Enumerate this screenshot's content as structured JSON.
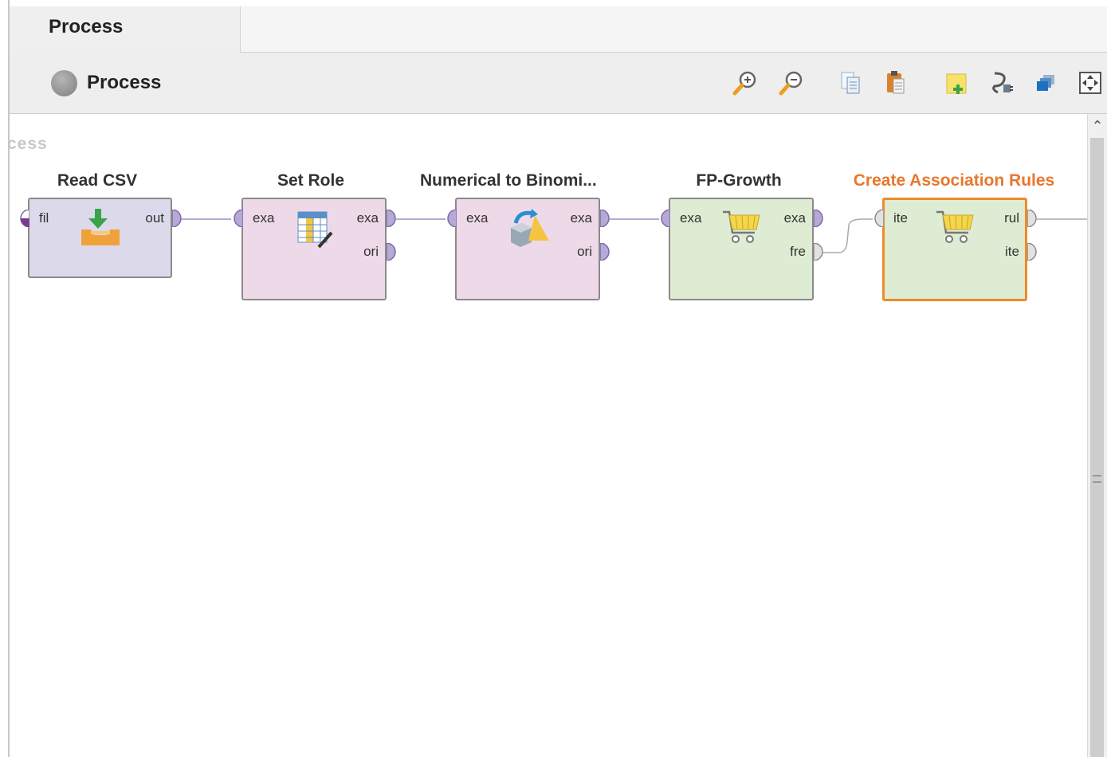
{
  "tab": {
    "label": "Process"
  },
  "toolbar": {
    "breadcrumb_label": "Process",
    "icons": [
      "zoom-in-icon",
      "zoom-out-icon",
      "copy-icon",
      "paste-icon",
      "add-note-icon",
      "auto-wire-icon",
      "arrange-icon",
      "fit-view-icon"
    ]
  },
  "canvas": {
    "label": "cess"
  },
  "operators": [
    {
      "name": "Read CSV",
      "fill": "#dcdaea",
      "inputs": [
        "fil"
      ],
      "outputs": [
        "out"
      ]
    },
    {
      "name": "Set Role",
      "fill": "#eed9e8",
      "inputs": [
        "exa"
      ],
      "outputs": [
        "exa",
        "ori"
      ]
    },
    {
      "name": "Numerical to Binomi...",
      "fill": "#eed9e8",
      "inputs": [
        "exa"
      ],
      "outputs": [
        "exa",
        "ori"
      ]
    },
    {
      "name": "FP-Growth",
      "fill": "#deecd3",
      "inputs": [
        "exa"
      ],
      "outputs": [
        "exa",
        "fre"
      ]
    },
    {
      "name": "Create Association Rules",
      "fill": "#deecd3",
      "selected": true,
      "inputs": [
        "ite"
      ],
      "outputs": [
        "rul",
        "ite"
      ]
    }
  ],
  "colors": {
    "selected": "#f08a2a",
    "port_example": "#b7a9d6",
    "port_other": "#cfcfcf",
    "wire": "#9c8fc8"
  }
}
